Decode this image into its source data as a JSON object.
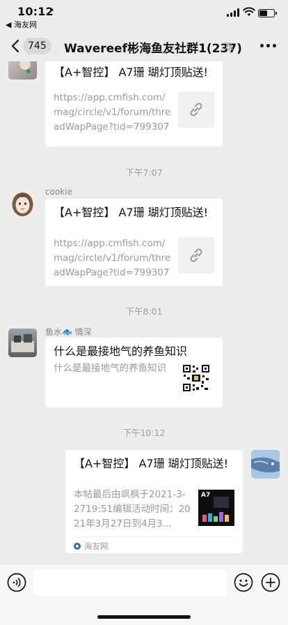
{
  "status_bar": {
    "time": "10:12",
    "back_app": "◀ 海友网"
  },
  "nav": {
    "unread_count": "745",
    "title": "Wavereef彬海鱼友社群1(237)"
  },
  "messages": [
    {
      "type": "link_card",
      "title": "【A+智控】 A7珊 瑚灯顶贴送!",
      "desc": "https://app.cmfish.com/mag/circle/v1/forum/threadWapPage?tid=799307&..."
    },
    {
      "type": "time",
      "text": "下午7:07"
    },
    {
      "type": "link_card",
      "sender": "cookie",
      "title": "【A+智控】 A7珊 瑚灯顶贴送!",
      "desc": "https://app.cmfish.com/mag/circle/v1/forum/threadWapPage?tid=799307&..."
    },
    {
      "type": "time",
      "text": "下午8:01"
    },
    {
      "type": "link_card",
      "sender": "鱼水🐟 情深",
      "title": "什么是最接地气的养鱼知识",
      "desc": "什么是最接地气的养鱼知识"
    },
    {
      "type": "time",
      "text": "下午10:12"
    },
    {
      "type": "link_card",
      "outgoing": true,
      "title": "【A+智控】 A7珊 瑚灯顶贴送!",
      "desc": "本帖最后由飒枫于2021-3-2719:51编辑活动时间：2021年3月27日到4月3...",
      "source": "海友网",
      "thumb_text": "A7"
    }
  ],
  "icons": {
    "back": "chevron-left-icon",
    "mute": "bell-slash-icon",
    "more": "more-dots-icon",
    "link": "link-icon",
    "voice": "voice-icon",
    "emoji": "emoji-icon",
    "plus": "plus-circle-icon"
  },
  "colors": {
    "background": "#ededed",
    "card": "#ffffff",
    "secondary_text": "#9a9a9a"
  }
}
